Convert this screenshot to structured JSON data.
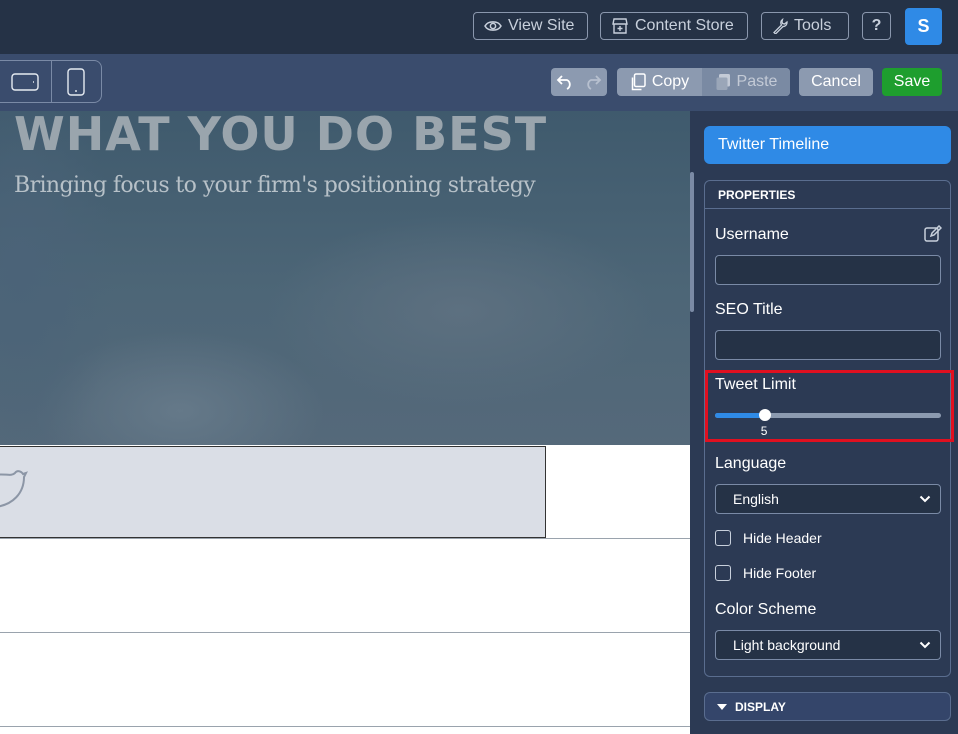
{
  "topbar": {
    "view_site": "View Site",
    "content_store": "Content Store",
    "tools": "Tools",
    "help": "?",
    "avatar": "S"
  },
  "toolbar": {
    "copy": "Copy",
    "paste": "Paste",
    "cancel": "Cancel",
    "save": "Save"
  },
  "hero": {
    "title": "WHAT YOU DO BEST",
    "subtitle": "Bringing focus to your firm's positioning strategy"
  },
  "panel": {
    "title": "Twitter Timeline",
    "properties_header": "PROPERTIES",
    "username_label": "Username",
    "username_value": "",
    "seo_title_label": "SEO Title",
    "seo_title_value": "",
    "tweet_limit_label": "Tweet Limit",
    "tweet_limit_value": "5",
    "tweet_limit_fraction": 0.22,
    "language_label": "Language",
    "language_value": "English",
    "hide_header_label": "Hide Header",
    "hide_header_checked": false,
    "hide_footer_label": "Hide Footer",
    "hide_footer_checked": false,
    "color_scheme_label": "Color Scheme",
    "color_scheme_value": "Light background",
    "display_header": "DISPLAY"
  },
  "colors": {
    "accent": "#2f8ae6",
    "save": "#1e9e2e",
    "highlight": "#e01020"
  }
}
